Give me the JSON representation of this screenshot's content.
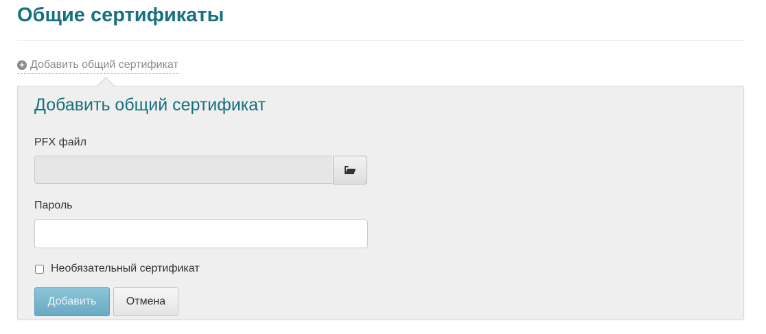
{
  "page": {
    "title": "Общие сертификаты",
    "add_link_label": "Добавить общий сертификат"
  },
  "form": {
    "title": "Добавить общий сертификат",
    "pfx_label": "PFX файл",
    "pfx_value": "",
    "password_label": "Пароль",
    "password_value": "",
    "optional_checkbox_label": "Необязательный сертификат",
    "optional_checked": false,
    "add_button_label": "Добавить",
    "cancel_button_label": "Отмена"
  },
  "icons": {
    "add_link_icon": "plus-circle-icon",
    "browse_icon": "folder-open-icon"
  },
  "colors": {
    "accent": "#16707f",
    "primary_button": "#68aac3",
    "panel_background": "#efefef"
  }
}
